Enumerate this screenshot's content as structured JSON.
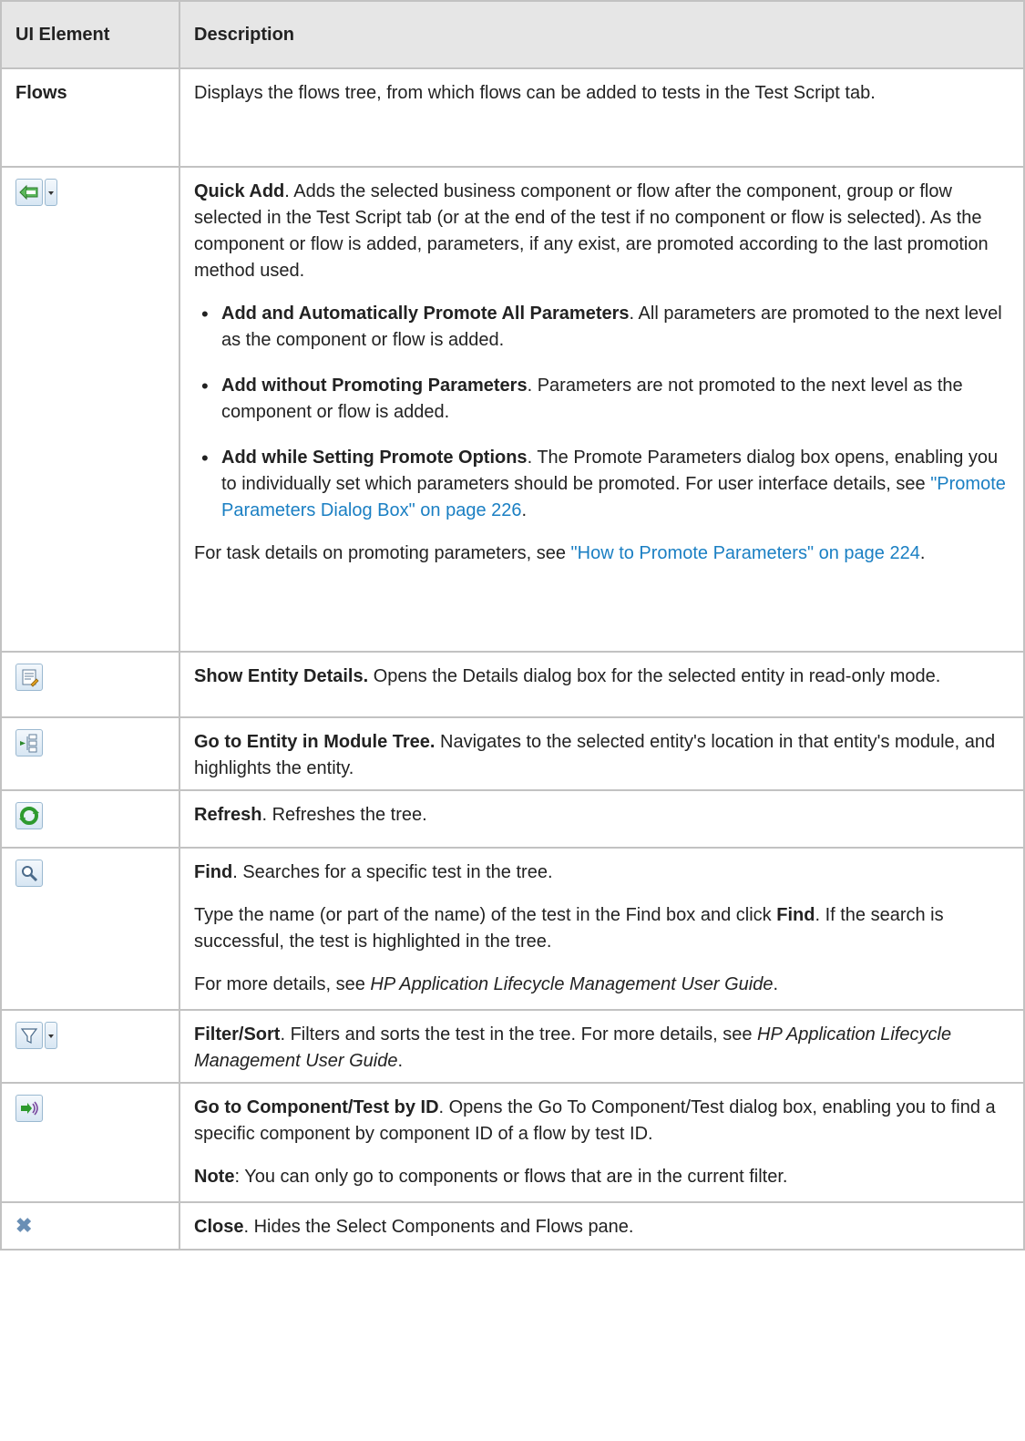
{
  "header": {
    "col1": "UI Element",
    "col2": "Description"
  },
  "rows": {
    "flows": {
      "label": "Flows",
      "desc": "Displays the flows tree, from which flows can be added to tests in the Test Script tab."
    },
    "quick_add": {
      "title": "Quick Add",
      "desc": ". Adds the selected business component or flow after the component, group or flow selected in the Test Script tab (or at the end of the test if no component or flow is selected). As the component or flow is added, parameters, if any exist, are promoted according to the last promotion method used.",
      "opt1_title": "Add and Automatically Promote All Parameters",
      "opt1_desc": ". All parameters are promoted to the next level as the component or flow is added.",
      "opt2_title": "Add without Promoting Parameters",
      "opt2_desc": ". Parameters are not promoted to the next level as the component or flow is added.",
      "opt3_title": "Add while Setting Promote Options",
      "opt3_desc": ". The Promote Parameters dialog box opens, enabling you to individually set which parameters should be promoted. For user interface details, see ",
      "opt3_link": "\"Promote Parameters Dialog Box\" on page 226",
      "task_prefix": "For task details on promoting parameters, see ",
      "task_link": "\"How to Promote Parameters\" on page 224",
      "period": "."
    },
    "show_details": {
      "title": "Show Entity Details.",
      "desc": " Opens the Details dialog box for the selected entity in read-only mode."
    },
    "go_to_entity": {
      "title": "Go to Entity in Module Tree.",
      "desc": " Navigates to the selected entity's location in that entity's module, and highlights the entity."
    },
    "refresh": {
      "title": "Refresh",
      "desc": ". Refreshes the tree."
    },
    "find": {
      "title": "Find",
      "desc": ". Searches for a specific test in the tree.",
      "p2_a": "Type the name (or part of the name) of the test in the Find box and click ",
      "p2_b": "Find",
      "p2_c": ". If the search is successful, the test is highlighted in the tree.",
      "p3_a": "For more details, see ",
      "p3_i": "HP Application Lifecycle Management User Guide",
      "p3_c": "."
    },
    "filter": {
      "title": "Filter/Sort",
      "desc": ". Filters and sorts the test in the tree. For more details, see ",
      "italic": "HP Application Lifecycle Management User Guide",
      "end": "."
    },
    "go_to_component": {
      "title": "Go to Component/Test by ID",
      "desc": ". Opens the Go To Component/Test dialog box, enabling you to find a specific component by component ID of a flow by test ID.",
      "note_label": "Note",
      "note_text": ": You can only go to components or flows that are in the current filter."
    },
    "close": {
      "title": "Close",
      "desc": ". Hides the Select Components and Flows pane."
    }
  },
  "icons": {
    "quick_add": "arrow-left-icon",
    "show_details": "details-icon",
    "go_to_entity": "module-tree-icon",
    "refresh": "refresh-icon",
    "find": "magnifier-icon",
    "filter": "filter-icon",
    "go_to_component": "go-to-id-icon",
    "close": "close-icon"
  }
}
